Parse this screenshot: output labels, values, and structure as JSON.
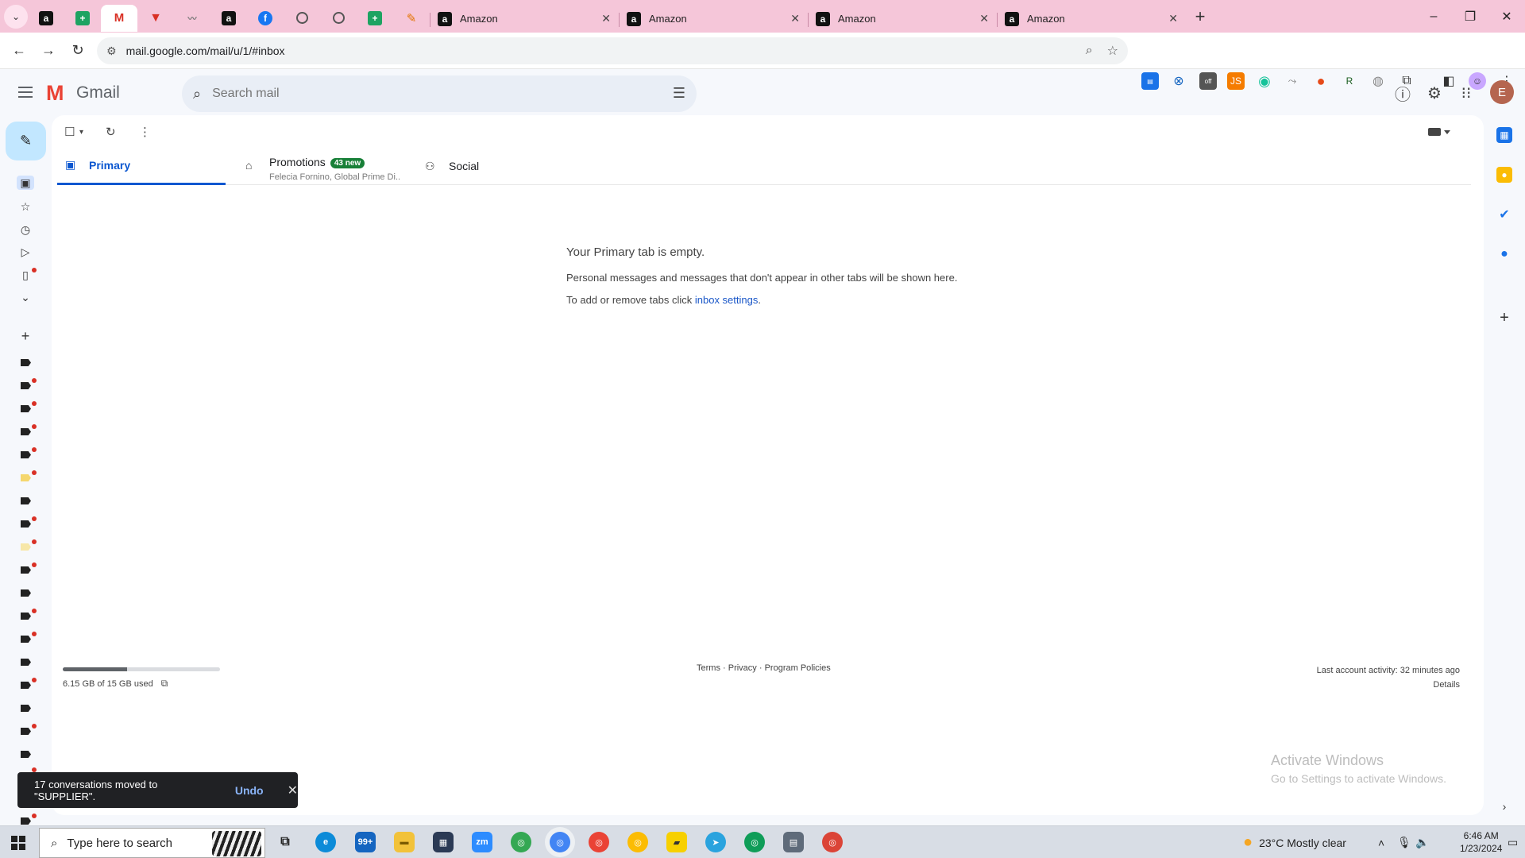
{
  "browser": {
    "tabs": [
      {
        "title": "Amazon"
      },
      {
        "title": "Amazon"
      },
      {
        "title": "Amazon"
      },
      {
        "title": "Amazon"
      }
    ],
    "url": "mail.google.com/mail/u/1/#inbox"
  },
  "gmail": {
    "brand": "Gmail",
    "search_placeholder": "Search mail",
    "avatar_letter": "E",
    "tabs": {
      "primary": "Primary",
      "promotions": "Promotions",
      "promotions_badge": "43 new",
      "promotions_senders": "Felecia Fornino, Global Prime Di...",
      "social": "Social"
    },
    "empty": {
      "title": "Your Primary tab is empty.",
      "line1": "Personal messages and messages that don't appear in other tabs will be shown here.",
      "line2_prefix": "To add or remove tabs click ",
      "line2_link": "inbox settings",
      "line2_suffix": "."
    },
    "storage": {
      "text": "6.15 GB of 15 GB used",
      "used_fraction": 0.41
    },
    "footer": {
      "terms": "Terms",
      "privacy": "Privacy",
      "policies": "Program Policies",
      "separator": " · "
    },
    "activity": {
      "last": "Last account activity: 32 minutes ago",
      "details": "Details"
    },
    "snackbar": {
      "message": "17 conversations moved to \"SUPPLIER\".",
      "undo": "Undo"
    }
  },
  "watermark": {
    "line1": "Activate Windows",
    "line2": "Go to Settings to activate Windows."
  },
  "taskbar": {
    "search_placeholder": "Type here to search",
    "mail_badge": "99+",
    "zoom_label": "zm",
    "weather": "23°C  Mostly clear",
    "time": "6:46 AM",
    "date": "1/23/2024"
  },
  "colors": {
    "tabstrip": "#f5c6d9",
    "accent": "#0b57d0",
    "badge_green": "#188038",
    "compose": "#c2e7ff"
  }
}
